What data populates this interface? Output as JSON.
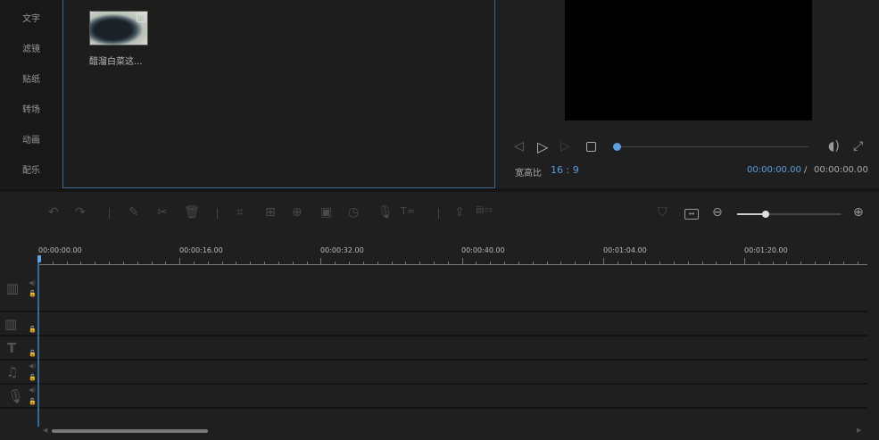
{
  "sidebar": {
    "items": [
      {
        "label": "文字"
      },
      {
        "label": "滤镜"
      },
      {
        "label": "贴纸"
      },
      {
        "label": "转场"
      },
      {
        "label": "动画"
      },
      {
        "label": "配乐"
      }
    ]
  },
  "media": {
    "clips": [
      {
        "name": "醋溜白菜这..."
      }
    ]
  },
  "preview": {
    "aspect_label": "宽高比",
    "aspect_value": "16 : 9",
    "current_time": "00:00:00.00",
    "separator": "/",
    "total_time": "00:00:00.00",
    "progress": 0
  },
  "timeline": {
    "ruler_labels": [
      "00:00:00.00",
      "00:00:16.00",
      "00:00:32.00",
      "00:00:40.00",
      "00:01:04.00",
      "00:01:20.00"
    ],
    "zoom_level": 0.27
  },
  "colors": {
    "accent": "#5a9fe0",
    "panel_border": "#3d6a94",
    "playhead": "#2f6d96"
  }
}
